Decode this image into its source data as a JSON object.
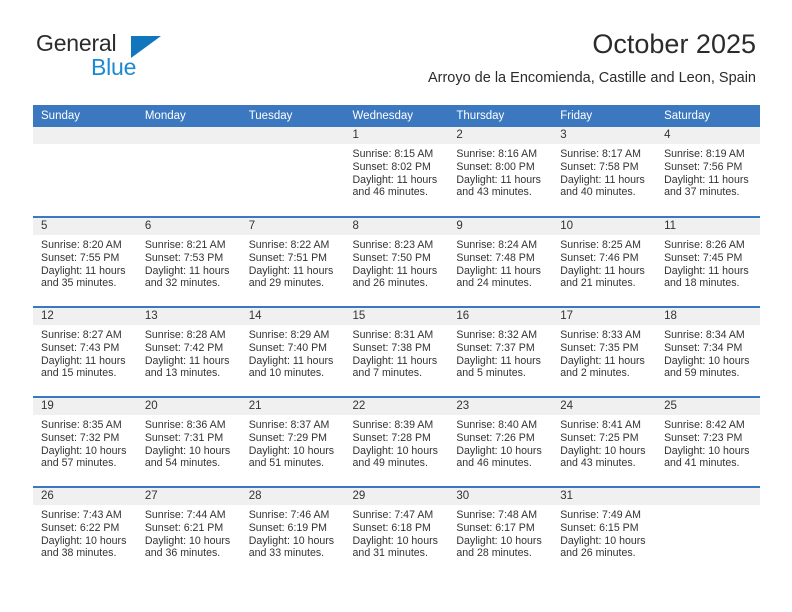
{
  "brand": {
    "line1": "General",
    "line2": "Blue",
    "triangle_color": "#1276bd",
    "blue_text_color": "#1b8ad4"
  },
  "header": {
    "month_title": "October 2025",
    "location": "Arroyo de la Encomienda, Castille and Leon, Spain"
  },
  "theme": {
    "header_blue": "#3b78bf",
    "daynum_band": "#f0f0f0",
    "text": "#333333"
  },
  "weekdays": [
    "Sunday",
    "Monday",
    "Tuesday",
    "Wednesday",
    "Thursday",
    "Friday",
    "Saturday"
  ],
  "labels": {
    "sunrise_prefix": "Sunrise:",
    "sunset_prefix": "Sunset:",
    "daylight_prefix": "Daylight:"
  },
  "weeks": [
    [
      {
        "day": "",
        "empty": true
      },
      {
        "day": "",
        "empty": true
      },
      {
        "day": "",
        "empty": true
      },
      {
        "day": "1",
        "sunrise": "Sunrise: 8:15 AM",
        "sunset": "Sunset: 8:02 PM",
        "daylight": "Daylight: 11 hours and 46 minutes."
      },
      {
        "day": "2",
        "sunrise": "Sunrise: 8:16 AM",
        "sunset": "Sunset: 8:00 PM",
        "daylight": "Daylight: 11 hours and 43 minutes."
      },
      {
        "day": "3",
        "sunrise": "Sunrise: 8:17 AM",
        "sunset": "Sunset: 7:58 PM",
        "daylight": "Daylight: 11 hours and 40 minutes."
      },
      {
        "day": "4",
        "sunrise": "Sunrise: 8:19 AM",
        "sunset": "Sunset: 7:56 PM",
        "daylight": "Daylight: 11 hours and 37 minutes."
      }
    ],
    [
      {
        "day": "5",
        "sunrise": "Sunrise: 8:20 AM",
        "sunset": "Sunset: 7:55 PM",
        "daylight": "Daylight: 11 hours and 35 minutes."
      },
      {
        "day": "6",
        "sunrise": "Sunrise: 8:21 AM",
        "sunset": "Sunset: 7:53 PM",
        "daylight": "Daylight: 11 hours and 32 minutes."
      },
      {
        "day": "7",
        "sunrise": "Sunrise: 8:22 AM",
        "sunset": "Sunset: 7:51 PM",
        "daylight": "Daylight: 11 hours and 29 minutes."
      },
      {
        "day": "8",
        "sunrise": "Sunrise: 8:23 AM",
        "sunset": "Sunset: 7:50 PM",
        "daylight": "Daylight: 11 hours and 26 minutes."
      },
      {
        "day": "9",
        "sunrise": "Sunrise: 8:24 AM",
        "sunset": "Sunset: 7:48 PM",
        "daylight": "Daylight: 11 hours and 24 minutes."
      },
      {
        "day": "10",
        "sunrise": "Sunrise: 8:25 AM",
        "sunset": "Sunset: 7:46 PM",
        "daylight": "Daylight: 11 hours and 21 minutes."
      },
      {
        "day": "11",
        "sunrise": "Sunrise: 8:26 AM",
        "sunset": "Sunset: 7:45 PM",
        "daylight": "Daylight: 11 hours and 18 minutes."
      }
    ],
    [
      {
        "day": "12",
        "sunrise": "Sunrise: 8:27 AM",
        "sunset": "Sunset: 7:43 PM",
        "daylight": "Daylight: 11 hours and 15 minutes."
      },
      {
        "day": "13",
        "sunrise": "Sunrise: 8:28 AM",
        "sunset": "Sunset: 7:42 PM",
        "daylight": "Daylight: 11 hours and 13 minutes."
      },
      {
        "day": "14",
        "sunrise": "Sunrise: 8:29 AM",
        "sunset": "Sunset: 7:40 PM",
        "daylight": "Daylight: 11 hours and 10 minutes."
      },
      {
        "day": "15",
        "sunrise": "Sunrise: 8:31 AM",
        "sunset": "Sunset: 7:38 PM",
        "daylight": "Daylight: 11 hours and 7 minutes."
      },
      {
        "day": "16",
        "sunrise": "Sunrise: 8:32 AM",
        "sunset": "Sunset: 7:37 PM",
        "daylight": "Daylight: 11 hours and 5 minutes."
      },
      {
        "day": "17",
        "sunrise": "Sunrise: 8:33 AM",
        "sunset": "Sunset: 7:35 PM",
        "daylight": "Daylight: 11 hours and 2 minutes."
      },
      {
        "day": "18",
        "sunrise": "Sunrise: 8:34 AM",
        "sunset": "Sunset: 7:34 PM",
        "daylight": "Daylight: 10 hours and 59 minutes."
      }
    ],
    [
      {
        "day": "19",
        "sunrise": "Sunrise: 8:35 AM",
        "sunset": "Sunset: 7:32 PM",
        "daylight": "Daylight: 10 hours and 57 minutes."
      },
      {
        "day": "20",
        "sunrise": "Sunrise: 8:36 AM",
        "sunset": "Sunset: 7:31 PM",
        "daylight": "Daylight: 10 hours and 54 minutes."
      },
      {
        "day": "21",
        "sunrise": "Sunrise: 8:37 AM",
        "sunset": "Sunset: 7:29 PM",
        "daylight": "Daylight: 10 hours and 51 minutes."
      },
      {
        "day": "22",
        "sunrise": "Sunrise: 8:39 AM",
        "sunset": "Sunset: 7:28 PM",
        "daylight": "Daylight: 10 hours and 49 minutes."
      },
      {
        "day": "23",
        "sunrise": "Sunrise: 8:40 AM",
        "sunset": "Sunset: 7:26 PM",
        "daylight": "Daylight: 10 hours and 46 minutes."
      },
      {
        "day": "24",
        "sunrise": "Sunrise: 8:41 AM",
        "sunset": "Sunset: 7:25 PM",
        "daylight": "Daylight: 10 hours and 43 minutes."
      },
      {
        "day": "25",
        "sunrise": "Sunrise: 8:42 AM",
        "sunset": "Sunset: 7:23 PM",
        "daylight": "Daylight: 10 hours and 41 minutes."
      }
    ],
    [
      {
        "day": "26",
        "sunrise": "Sunrise: 7:43 AM",
        "sunset": "Sunset: 6:22 PM",
        "daylight": "Daylight: 10 hours and 38 minutes."
      },
      {
        "day": "27",
        "sunrise": "Sunrise: 7:44 AM",
        "sunset": "Sunset: 6:21 PM",
        "daylight": "Daylight: 10 hours and 36 minutes."
      },
      {
        "day": "28",
        "sunrise": "Sunrise: 7:46 AM",
        "sunset": "Sunset: 6:19 PM",
        "daylight": "Daylight: 10 hours and 33 minutes."
      },
      {
        "day": "29",
        "sunrise": "Sunrise: 7:47 AM",
        "sunset": "Sunset: 6:18 PM",
        "daylight": "Daylight: 10 hours and 31 minutes."
      },
      {
        "day": "30",
        "sunrise": "Sunrise: 7:48 AM",
        "sunset": "Sunset: 6:17 PM",
        "daylight": "Daylight: 10 hours and 28 minutes."
      },
      {
        "day": "31",
        "sunrise": "Sunrise: 7:49 AM",
        "sunset": "Sunset: 6:15 PM",
        "daylight": "Daylight: 10 hours and 26 minutes."
      },
      {
        "day": "",
        "empty": true
      }
    ]
  ]
}
